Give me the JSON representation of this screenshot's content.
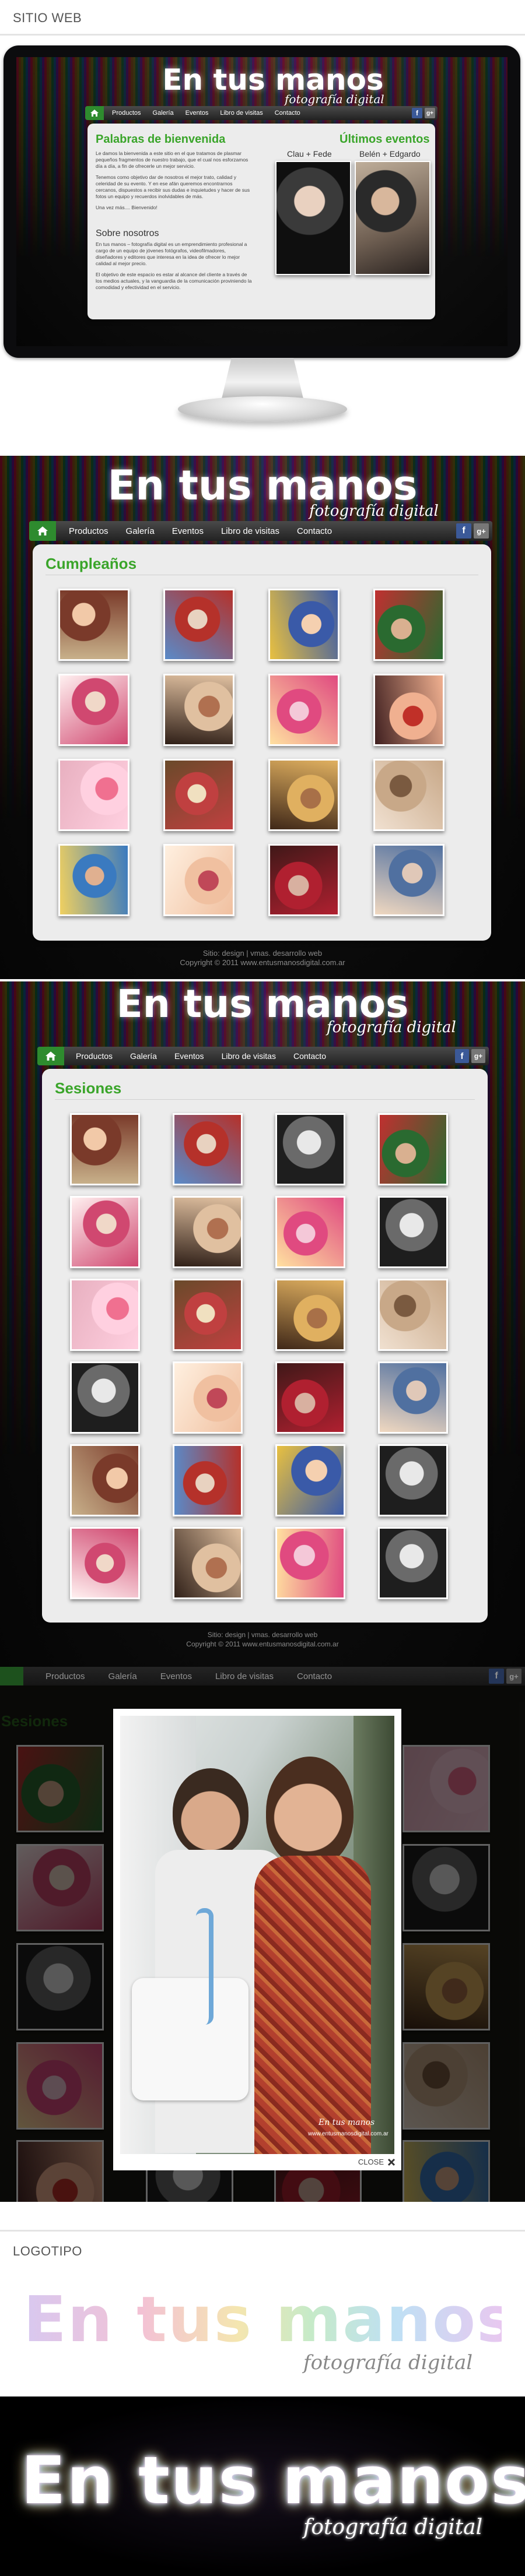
{
  "sections": {
    "web_label": "SITIO WEB",
    "logo_label": "LOGOTIPO"
  },
  "brand": {
    "name": "En tus manos",
    "tagline": "fotografía digital"
  },
  "nav": {
    "items": [
      "Productos",
      "Galería",
      "Eventos",
      "Libro de visitas",
      "Contacto"
    ],
    "social": [
      "f",
      "g+"
    ]
  },
  "home": {
    "welcome_title": "Palabras de bienvenida",
    "welcome_p1": "Le damos la bienvenida a este sitio en el que tratamos de plasmar pequeños fragmentos de nuestro trabajo, que el cual nos esforzamos día a día, a fin de ofrecerle un mejor servicio.",
    "welcome_p2": "Tenemos como objetivo dar de nosotros el mejor trato, calidad y celeridad de su evento. Y en ese afán queremos encontrarnos cercanos, dispuestos a recibir sus dudas e inquietudes y hacer de sus fotos un equipo y recuerdos inolvidables de más.",
    "welcome_p3": "Una vez más.... Bienvenido!",
    "about_title": "Sobre nosotros",
    "about_p1": "En tus manos – fotografía digital es un emprendimiento profesional a cargo de un equipo de jóvenes fotógrafos, videofilmadores, diseñadores y editores que interesa en la idea de ofrecer lo mejor calidad al mejor precio.",
    "about_p2": "El objetivo de este espacio es estar al alcance del cliente a través de los medios actuales, y la vanguardia de la comunicación proviniendo la comodidad y efectividad en el servicio.",
    "events_title": "Últimos eventos",
    "event_1": "Clau + Fede",
    "event_2": "Belén + Edgardo"
  },
  "birthdays": {
    "title": "Cumpleaños",
    "photo_count": 16,
    "footer_1": "Sitio: design | vmas. desarrollo web",
    "footer_2": "Copyright © 2011 www.entusmanosdigital.com.ar"
  },
  "sessions": {
    "title": "Sesiones",
    "photo_count": 24,
    "footer_1": "Sitio: design | vmas. desarrollo web",
    "footer_2": "Copyright © 2011 www.entusmanosdigital.com.ar"
  },
  "lightbox": {
    "close_label": "CLOSE",
    "watermark_1": "En tus manos",
    "watermark_2": "www.entusmanosdigital.com.ar"
  },
  "colors": {
    "accent_green": "#3aa52a",
    "nav_dark": "#2b2b2b",
    "facebook_blue": "#3b5998"
  }
}
